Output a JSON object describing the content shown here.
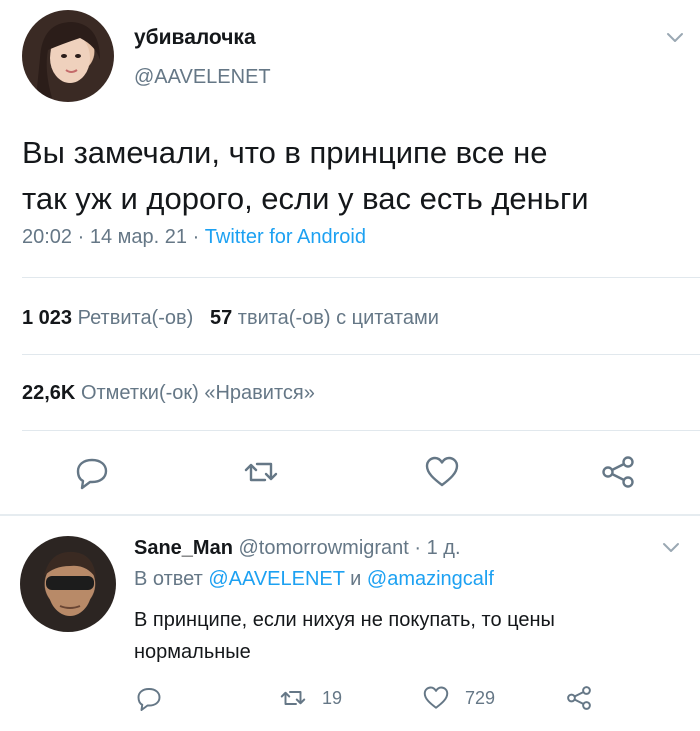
{
  "tweet": {
    "display_name": "убивалочка",
    "handle": "@AAVELENET",
    "text_line1": "Вы замечали, что в принципе все не",
    "text_line2": "так уж и дорого, если у вас есть деньги",
    "time": "20:02",
    "date": "14 мар. 21",
    "source": "Twitter for Android",
    "retweets_count": "1 023",
    "retweets_label": "Ретвита(-ов)",
    "quotes_count": "57",
    "quotes_label": "твита(-ов) с цитатами",
    "likes_count": "22,6K",
    "likes_label": "Отметки(-ок) «Нравится»",
    "actions": {
      "reply_icon": "reply-icon",
      "retweet_icon": "retweet-icon",
      "like_icon": "heart-icon",
      "share_icon": "share-icon"
    }
  },
  "reply": {
    "display_name": "Sane_Man",
    "handle": "@tomorrowmigrant",
    "age": "1 д.",
    "reply_prefix": "В ответ",
    "reply_user1": "@AAVELENET",
    "reply_conj": "и",
    "reply_user2": "@amazingcalf",
    "text_line1": "В принципе, если нихуя не покупать, то цены",
    "text_line2": "нормальные",
    "retweet_count": "19",
    "like_count": "729"
  },
  "colors": {
    "text": "#14171a",
    "muted": "#657786",
    "link": "#1da1f2",
    "divider": "#e1e8ed"
  }
}
